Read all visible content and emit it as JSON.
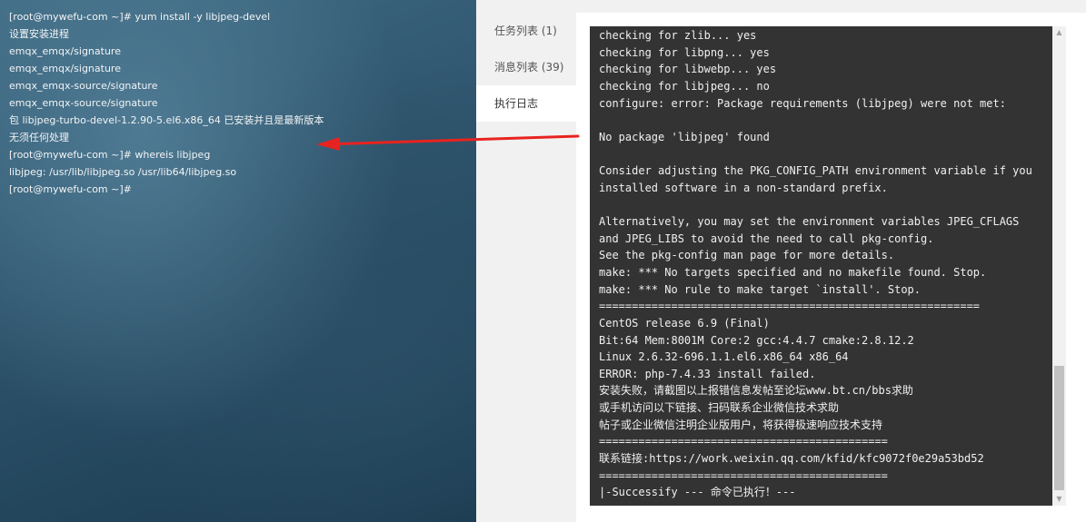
{
  "terminal": {
    "lines": [
      "[root@mywefu-com ~]# yum install -y libjpeg-devel",
      "设置安装进程",
      "emqx_emqx/signature",
      "emqx_emqx/signature",
      "emqx_emqx-source/signature",
      "emqx_emqx-source/signature",
      "包 libjpeg-turbo-devel-1.2.90-5.el6.x86_64 已安装并且是最新版本",
      "无须任何处理",
      "[root@mywefu-com ~]# whereis libjpeg",
      "libjpeg: /usr/lib/libjpeg.so /usr/lib64/libjpeg.so",
      "[root@mywefu-com ~]#"
    ]
  },
  "annotation": {
    "arrow_color": "#e8231f"
  },
  "panel": {
    "tabs": [
      {
        "label": "任务列表 (1)"
      },
      {
        "label": "消息列表 (39)"
      },
      {
        "label": "执行日志"
      }
    ],
    "active_tab": "执行日志"
  },
  "log": {
    "lines": [
      "checking for zlib... yes",
      "checking for libpng... yes",
      "checking for libwebp... yes",
      "checking for libjpeg... no",
      "configure: error: Package requirements (libjpeg) were not met:",
      "",
      "No package 'libjpeg' found",
      "",
      "Consider adjusting the PKG_CONFIG_PATH environment variable if you",
      "installed software in a non-standard prefix.",
      "",
      "Alternatively, you may set the environment variables JPEG_CFLAGS",
      "and JPEG_LIBS to avoid the need to call pkg-config.",
      "See the pkg-config man page for more details.",
      "make: *** No targets specified and no makefile found. Stop.",
      "make: *** No rule to make target `install'. Stop.",
      "==========================================================",
      "CentOS release 6.9 (Final)",
      "Bit:64 Mem:8001M Core:2 gcc:4.4.7 cmake:2.8.12.2",
      "Linux 2.6.32-696.1.1.el6.x86_64 x86_64",
      "ERROR: php-7.4.33 install failed.",
      "安装失败，请截图以上报错信息发帖至论坛www.bt.cn/bbs求助",
      "或手机访问以下链接、扫码联系企业微信技术求助",
      "帖子或企业微信注明企业版用户，将获得极速响应技术支持",
      "============================================",
      "联系链接:https://work.weixin.qq.com/kfid/kfc9072f0e29a53bd52",
      "============================================",
      "|-Successify --- 命令已执行！---"
    ],
    "background": "#333333",
    "text_color": "#f0f0f0"
  },
  "scrollbar": {
    "up_icon": "▲",
    "down_icon": "▼",
    "position": 0.95
  }
}
